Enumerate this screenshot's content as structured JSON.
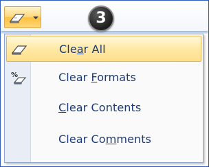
{
  "toolbar": {
    "clear_button_icon": "eraser-icon",
    "dropdown_icon": "chevron-down-icon"
  },
  "callout": {
    "step_number": "3"
  },
  "menu": {
    "items": [
      {
        "pre": "Cle",
        "key": "a",
        "post": "r All",
        "icon": "eraser-icon"
      },
      {
        "pre": "Clear ",
        "key": "F",
        "post": "ormats",
        "icon": "clear-formats-icon"
      },
      {
        "pre": "",
        "key": "C",
        "post": "lear Contents",
        "icon": ""
      },
      {
        "pre": "Clear Co",
        "key": "m",
        "post": "ments",
        "icon": ""
      }
    ]
  },
  "colors": {
    "frame_border": "#2f5fb8",
    "hover_fill": "#ffe08a",
    "menu_text": "#1c3a76"
  }
}
